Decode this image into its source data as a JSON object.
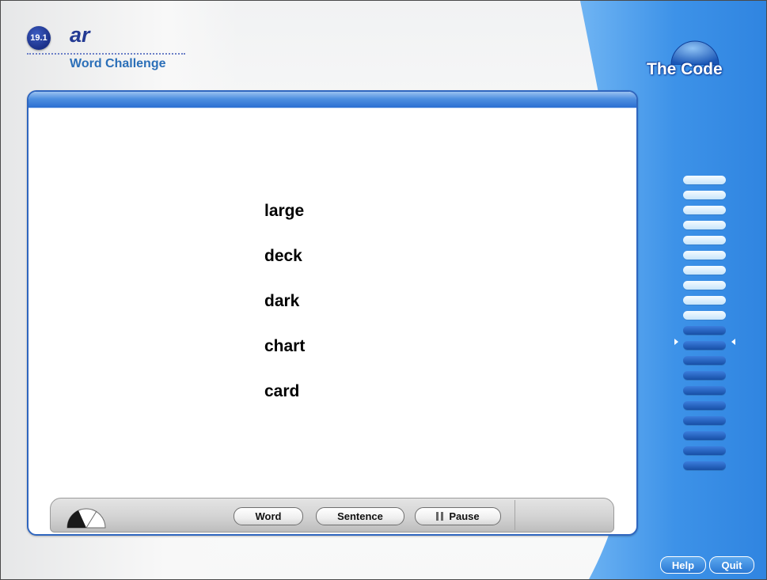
{
  "header": {
    "lesson_number": "19.1",
    "sound": "ar",
    "activity": "Word Challenge"
  },
  "words": [
    "large",
    "deck",
    "dark",
    "chart",
    "card"
  ],
  "controls": {
    "word_label": "Word",
    "sentence_label": "Sentence",
    "pause_label": "Pause",
    "timer_icon": "pie-timer-icon",
    "pause_icon": "pause-icon"
  },
  "brand": {
    "name": "The Code"
  },
  "progress": {
    "total_segments": 20,
    "completed_segments": 10,
    "current_segment": 11
  },
  "footer": {
    "help_label": "Help",
    "quit_label": "Quit"
  },
  "colors": {
    "accent_blue": "#2a6fd2",
    "panel_border": "#2f66bf",
    "title_blue": "#2b6fb8",
    "lesson_blue": "#233a93"
  }
}
